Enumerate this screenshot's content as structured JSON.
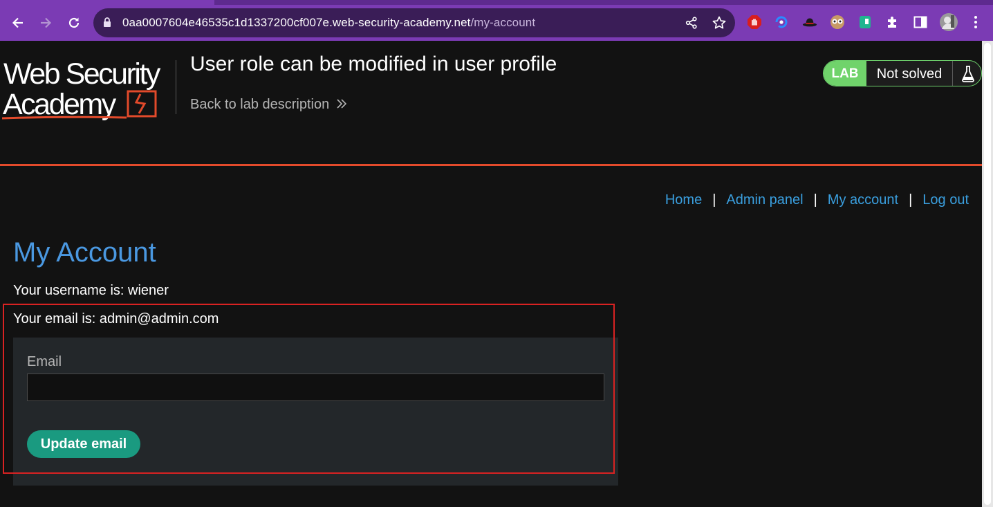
{
  "browser": {
    "url_host": "0aa0007604e46535c1d1337200cf007e.web-security-academy.net",
    "url_path": "/my-account",
    "theme_color": "#7b3bb4"
  },
  "header": {
    "logo_line1": "Web Security",
    "logo_line2": "Academy",
    "lab_title": "User role can be modified in user profile",
    "back_link": "Back to lab description",
    "badge_lab": "LAB",
    "badge_status": "Not solved"
  },
  "nav": {
    "home": "Home",
    "admin_panel": "Admin panel",
    "my_account": "My account",
    "log_out": "Log out",
    "separator": "|"
  },
  "main": {
    "heading": "My Account",
    "username_line": "Your username is: wiener",
    "email_line": "Your email is: admin@admin.com",
    "form": {
      "email_label": "Email",
      "email_value": "",
      "submit_label": "Update email"
    }
  },
  "colors": {
    "accent_red": "#e24a2b",
    "link_blue": "#3a9fdf",
    "heading_blue": "#4a98e1",
    "button_green": "#1a9a80",
    "lab_green": "#70d36b",
    "annotation_red": "#d92222"
  },
  "icons": [
    "back-arrow-icon",
    "forward-arrow-icon",
    "reload-icon",
    "lock-icon",
    "share-icon",
    "star-icon",
    "extension-icons",
    "puzzle-icon",
    "sidepanel-icon",
    "profile-avatar",
    "menu-dots-icon",
    "double-chevron-icon",
    "flask-icon"
  ]
}
